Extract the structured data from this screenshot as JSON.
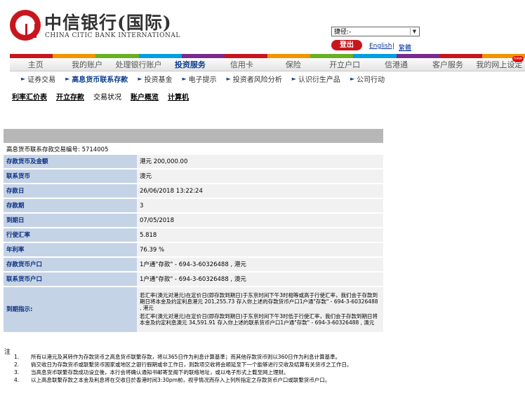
{
  "header": {
    "brand_cn": "中信银行(国际)",
    "brand_en": "CHINA CITIC BANK INTERNATIONAL",
    "shortcut_value": "捷径:-",
    "logout_label": "登出",
    "lang_en": "English",
    "lang_sep": "|",
    "lang_tc": "繁體"
  },
  "colors": {
    "brand_red": "#c8161d",
    "nav_blue": "#0b3f8f",
    "label_bg": "#c5d3e6",
    "value_bg": "#f1f1f1",
    "stripe": [
      "#c8161d",
      "#f29400",
      "#6ab023",
      "#009fe3",
      "#7a2a8c",
      "#c8161d",
      "#f29400",
      "#6ab023",
      "#009fe3",
      "#7a2a8c",
      "#c8161d",
      "#f29400"
    ]
  },
  "main_nav": [
    {
      "label": "主页"
    },
    {
      "label": "我的账户"
    },
    {
      "label": "处理银行账户"
    },
    {
      "label": "投资服务",
      "active": true
    },
    {
      "label": "信用卡"
    },
    {
      "label": "保险"
    },
    {
      "label": "开立户口"
    },
    {
      "label": "信港通"
    },
    {
      "label": "客户服务"
    },
    {
      "label": "我的网上设定",
      "badge": "new"
    }
  ],
  "sub_nav": [
    {
      "label": "证券交易"
    },
    {
      "label": "高息货币联系存款",
      "active": true
    },
    {
      "label": "投资基金"
    },
    {
      "label": "电子提示"
    },
    {
      "label": "投资者风险分析"
    },
    {
      "label": "认识衍生产品"
    },
    {
      "label": "公司行动"
    }
  ],
  "tabs": [
    {
      "label": "利率汇价表"
    },
    {
      "label": "开立存款"
    },
    {
      "label": "交易状况",
      "current": true
    },
    {
      "label": "账户概览"
    },
    {
      "label": "计算机"
    }
  ],
  "transaction": {
    "ref_label": "高息货币联系存款交易编号:",
    "ref_value": "5714005"
  },
  "details": [
    {
      "label": "存款货币及金额",
      "value": "港元   200,000.00"
    },
    {
      "label": "联系货币",
      "value": "澳元"
    },
    {
      "label": "存款日",
      "value": "26/06/2018 13:22:24"
    },
    {
      "label": "存款期",
      "value": "3"
    },
    {
      "label": "到期日",
      "value": "07/05/2018"
    },
    {
      "label": "行使汇率",
      "value": "5.818"
    },
    {
      "label": "年利率",
      "value": "76.39 %"
    },
    {
      "label": "存款货币户口",
      "value": "1户通\"存款\" - 694-3-60326488 , 港元"
    },
    {
      "label": "联系货币户口",
      "value": "1户通\"存款\" - 694-3-60326488 , 澳元"
    }
  ],
  "instruction": {
    "label": "到期指示:",
    "para1": "若汇率(澳元对港元)在定价日(即存款到期日)于东京时间下午3时相等或高于行使汇率，我们会于存款到期日将本金及约定利息港元 201,255.73 存入你上述的存款货币户口1户通\"存款\" - 694-3-60326488 , 港元",
    "para2": "若汇率(澳元对港元)在定价日(即存款到期日)于东京时间下午3时低于行使汇率，我们会于存款到期日将本金及约定利息澳元 34,591.91 存入你上述的联系货币户口1户通\"存款\" - 694-3-60326488 , 澳元"
  },
  "notes": {
    "title": "注",
    "items": [
      {
        "num": "1.",
        "text": "所有以港元及其转作为存款货币之高息货币联繫存款，将以365日作为利息计算基準；而其他存款货币则以360日作为利息计算基準。"
      },
      {
        "num": "2.",
        "text": "倘交收日为存款货币或联繫货币国家或地区之银行假期或非工作日，则款项交收将会顺延至下一个能够进行交收及结算有关货币之工作日。"
      },
      {
        "num": "3.",
        "text": "当高息货币联繫存款成功设立後，本行会将确认通知书邮寄至阁下的联络地址，或以电子形式上载至网上理财。"
      },
      {
        "num": "4.",
        "text": "以上高息联繫存款之本金及利息将在交收日於香港时间3:30pm前，视乎情况而存入上列所指定之存款货币户口或联繫货币户口。"
      }
    ]
  }
}
